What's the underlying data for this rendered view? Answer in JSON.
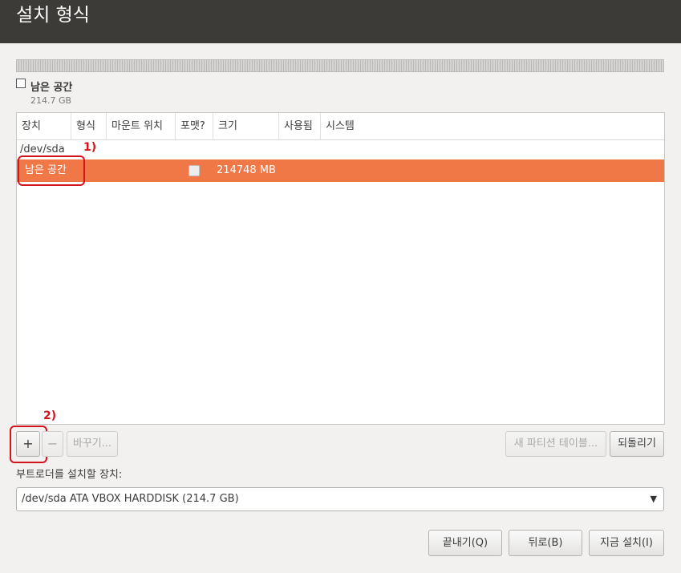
{
  "window": {
    "title": "설치 형식"
  },
  "legend": {
    "name": "남은 공간",
    "size": "214.7 GB"
  },
  "table": {
    "columns": [
      "장치",
      "형식",
      "마운트 위치",
      "포맷?",
      "크기",
      "사용됨",
      "시스템"
    ],
    "disk": "/dev/sda",
    "selected_row": {
      "device": "남은 공간",
      "format": false,
      "size": "214748 MB"
    }
  },
  "annotations": {
    "one": "1)",
    "two": "2)"
  },
  "toolbar": {
    "add_label": "+",
    "remove_label": "−",
    "change_label": "바꾸기...",
    "new_table_label": "새 파티션 테이블...",
    "revert_label": "되돌리기"
  },
  "bootloader": {
    "label": "부트로더를 설치할 장치:",
    "value": "/dev/sda ATA VBOX HARDDISK (214.7 GB)"
  },
  "footer": {
    "quit_label": "끝내기(Q)",
    "back_label": "뒤로(B)",
    "install_label": "지금 설치(I)"
  },
  "colors": {
    "selection": "#f07746",
    "header": "#3c3b37",
    "annotation": "#d4141b"
  },
  "icons": {
    "dropdown": "dropdown-arrow-icon",
    "checkbox": "checkbox-icon"
  }
}
